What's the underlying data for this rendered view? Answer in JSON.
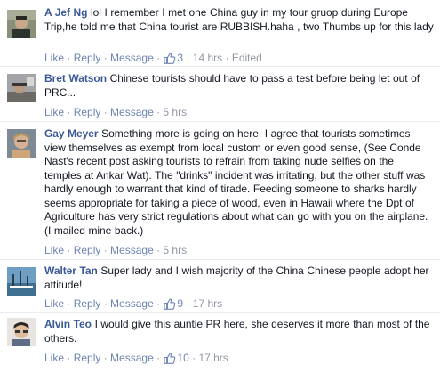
{
  "actions": {
    "like": "Like",
    "reply": "Reply",
    "message": "Message",
    "sep": " · "
  },
  "colors": {
    "author": "#3b5998",
    "link": "#6d84b4",
    "meta": "#9197a3",
    "text": "#141823"
  },
  "comments": [
    {
      "author": "A Jef Ng",
      "text": "lol I remember I met one China guy in my tour gruop during Europe Trip,he told me that China tourist are RUBBISH.haha , two Thumbs up for this lady",
      "likes": "3",
      "time": "14 hrs",
      "edited": "Edited",
      "avatar_icon": "profile-photo-icon"
    },
    {
      "author": "Bret Watson",
      "text": "Chinese tourists should have to pass a test before being let out of PRC...",
      "likes": "",
      "time": "5 hrs",
      "avatar_icon": "profile-photo-icon"
    },
    {
      "author": "Gay Meyer",
      "text": "Something more is going on here. I agree that tourists sometimes view themselves as exempt from local custom or even good sense, (See Conde Nast's recent post asking tourists to refrain from taking nude selfies on the temples at Ankar Wat). The \"drinks\" incident was irritating, but the other stuff was hardly enough to warrant that kind of tirade. Feeding someone to sharks hardly seems appropriate for taking a piece of wood, even in Hawaii where the Dpt of Agriculture has very strict regulations about what can go with you on the airplane. (I mailed mine back.)",
      "likes": "",
      "time": "5 hrs",
      "avatar_icon": "profile-photo-icon"
    },
    {
      "author": "Walter Tan",
      "text": "Super lady and I wish majority of the China Chinese people adopt her attitude!",
      "likes": "9",
      "time": "17 hrs",
      "avatar_icon": "profile-photo-icon"
    },
    {
      "author": "Alvin Teo",
      "text": "I would give this auntie PR here, she deserves it more than most of the others.",
      "likes": "10",
      "time": "17 hrs",
      "avatar_icon": "profile-photo-icon"
    }
  ]
}
